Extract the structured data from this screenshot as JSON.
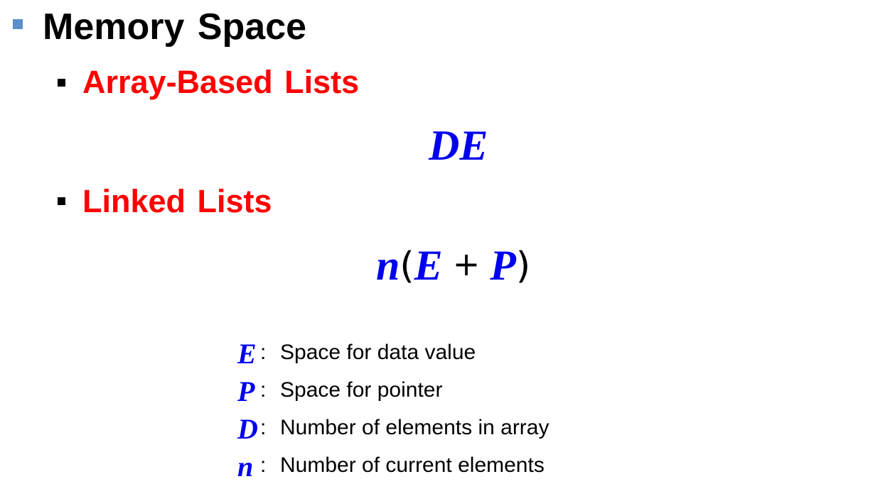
{
  "slide": {
    "title": "Memory Space",
    "sections": [
      {
        "heading": "Array-Based Lists",
        "formula": {
          "symbols": [
            "D",
            "E"
          ]
        }
      },
      {
        "heading": "Linked Lists",
        "formula": {
          "coefficient": "n",
          "open_paren": "(",
          "term1": "E",
          "operator": "+",
          "term2": "P",
          "close_paren": ")"
        }
      }
    ],
    "legend": [
      {
        "symbol": "E",
        "colon": ":",
        "description": "Space for data value"
      },
      {
        "symbol": "P",
        "colon": ":",
        "description": "Space for pointer"
      },
      {
        "symbol": "D",
        "colon": ":",
        "description": "Number of elements in array"
      },
      {
        "symbol": "n",
        "colon": ":",
        "description": "Number of current elements"
      }
    ]
  },
  "colors": {
    "title": "#000000",
    "heading": "#ff0000",
    "variable": "#0000ee",
    "level1_bullet": "#5b8fcb",
    "level2_bullet": "#000000"
  }
}
